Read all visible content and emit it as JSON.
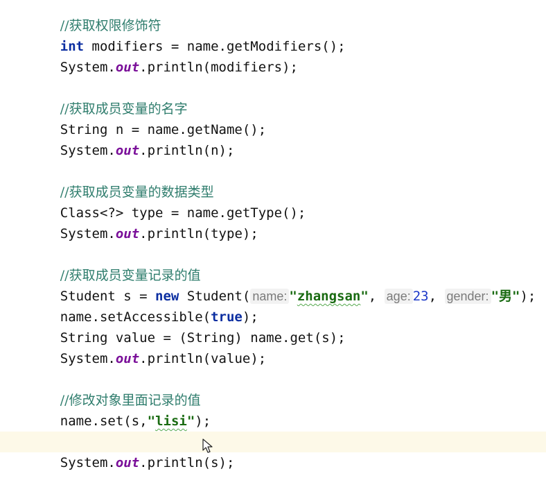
{
  "code": {
    "comment_modifiers": "//获取权限修饰符",
    "kw_int": "int",
    "stmt_modifiers": " modifiers = name.getModifiers();",
    "sys": "System.",
    "out": "out",
    "println_modifiers": ".println(modifiers);",
    "comment_name": "//获取成员变量的名字",
    "stmt_name": "String n = name.getName();",
    "println_n": ".println(n);",
    "comment_type": "//获取成员变量的数据类型",
    "stmt_type": "Class<?> type = name.getType();",
    "println_type": ".println(type);",
    "comment_value": "//获取成员变量记录的值",
    "student_prefix": "Student s = ",
    "kw_new": "new",
    "student_ctor": " Student(",
    "hint_name": "name:",
    "str_zhangsan_q1": "\"",
    "str_zhangsan": "zhangsan",
    "str_zhangsan_q2": "\"",
    "comma": ", ",
    "hint_age": "age:",
    "num_age": "23",
    "hint_gender": "gender:",
    "str_gender": "\"男\"",
    "ctor_close": ");",
    "setAccessible_prefix": "name.setAccessible(",
    "kw_true": "true",
    "setAccessible_suffix": ");",
    "stmt_value": "String value = (String) name.get(s);",
    "println_value": ".println(value);",
    "comment_modify": "//修改对象里面记录的值",
    "set_prefix": "name.set(s,",
    "str_lisi_q1": "\"",
    "str_lisi": "lisi",
    "str_lisi_q2": "\"",
    "set_suffix": ");",
    "println_s": ".println(s);"
  },
  "colors": {
    "keyword": "#0b2ea1",
    "comment": "#2f7d6d",
    "static_field": "#7a0f99",
    "string": "#1a6b12",
    "number": "#1b38c8",
    "current_line": "#fdf9e8"
  },
  "icons": {
    "cursor": "mouse-pointer-icon"
  }
}
